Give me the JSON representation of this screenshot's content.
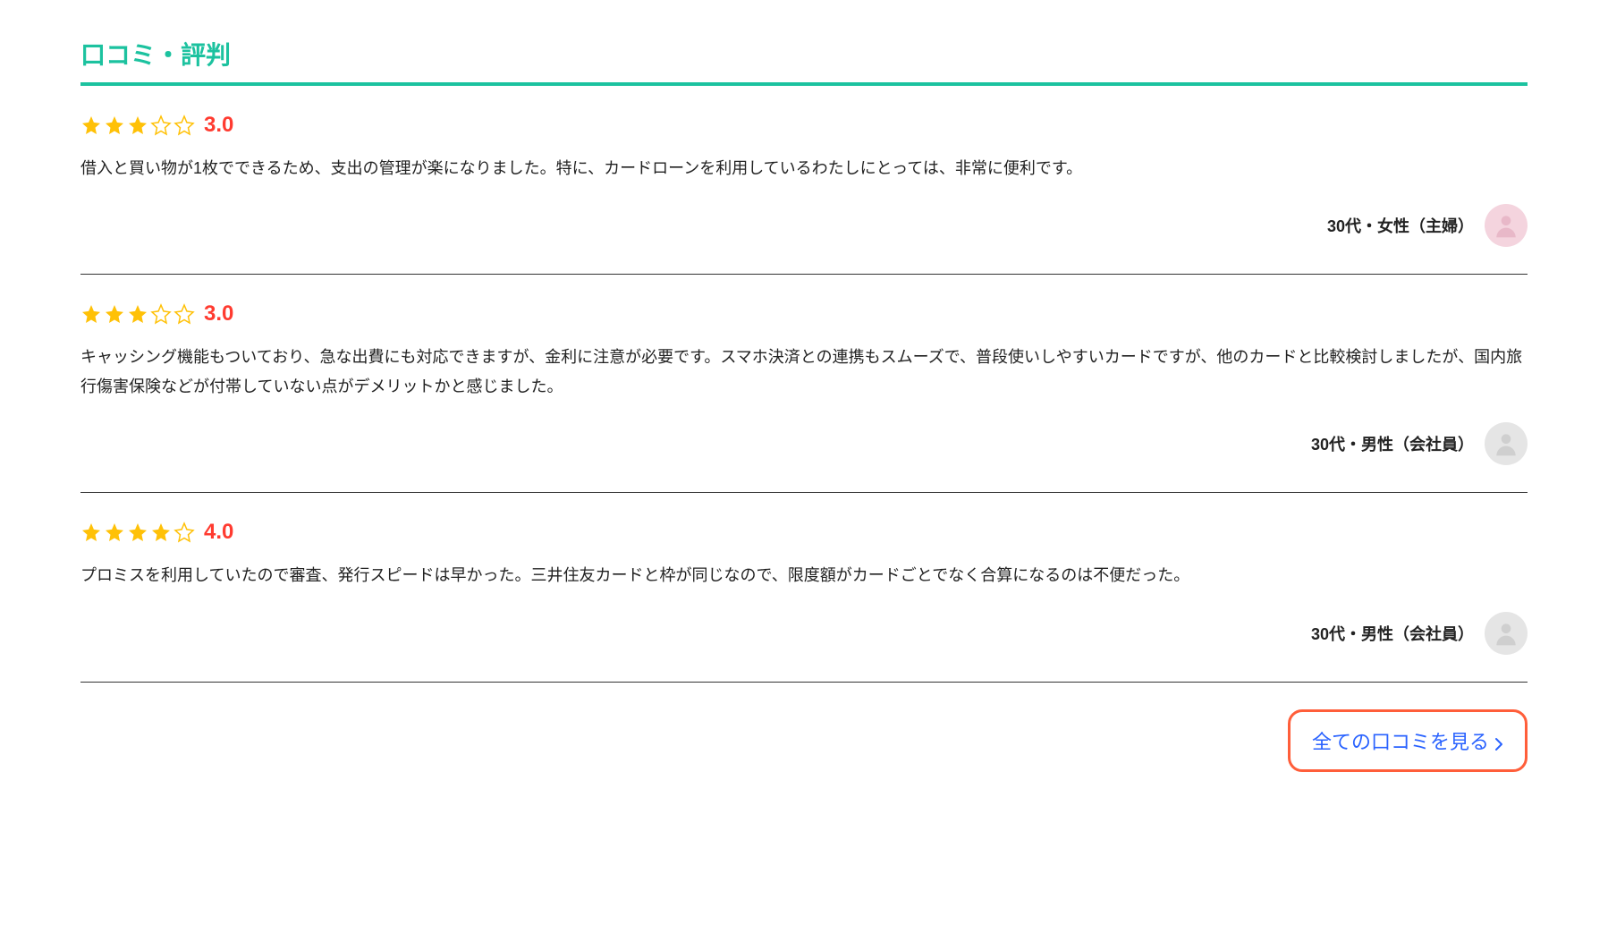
{
  "section_title": "口コミ・評判",
  "reviews": [
    {
      "rating": 3.0,
      "rating_display": "3.0",
      "text": "借入と買い物が1枚でできるため、支出の管理が楽になりました。特に、カードローンを利用しているわたしにとっては、非常に便利です。",
      "reviewer": "30代・女性（主婦）",
      "avatar_color": "pink"
    },
    {
      "rating": 3.0,
      "rating_display": "3.0",
      "text": "キャッシング機能もついており、急な出費にも対応できますが、金利に注意が必要です。スマホ決済との連携もスムーズで、普段使いしやすいカードですが、他のカードと比較検討しましたが、国内旅行傷害保険などが付帯していない点がデメリットかと感じました。",
      "reviewer": "30代・男性（会社員）",
      "avatar_color": "gray"
    },
    {
      "rating": 4.0,
      "rating_display": "4.0",
      "text": "プロミスを利用していたので審査、発行スピードは早かった。三井住友カードと枠が同じなので、限度額がカードごとでなく合算になるのは不便だった。",
      "reviewer": "30代・男性（会社員）",
      "avatar_color": "gray"
    }
  ],
  "see_all_label": "全ての口コミを見る",
  "colors": {
    "accent": "#1cc29f",
    "rating": "#ff3b30",
    "link": "#2962ff",
    "highlight_border": "#ff5e3a",
    "star_filled": "#ffc107",
    "star_empty_stroke": "#ffc107"
  }
}
